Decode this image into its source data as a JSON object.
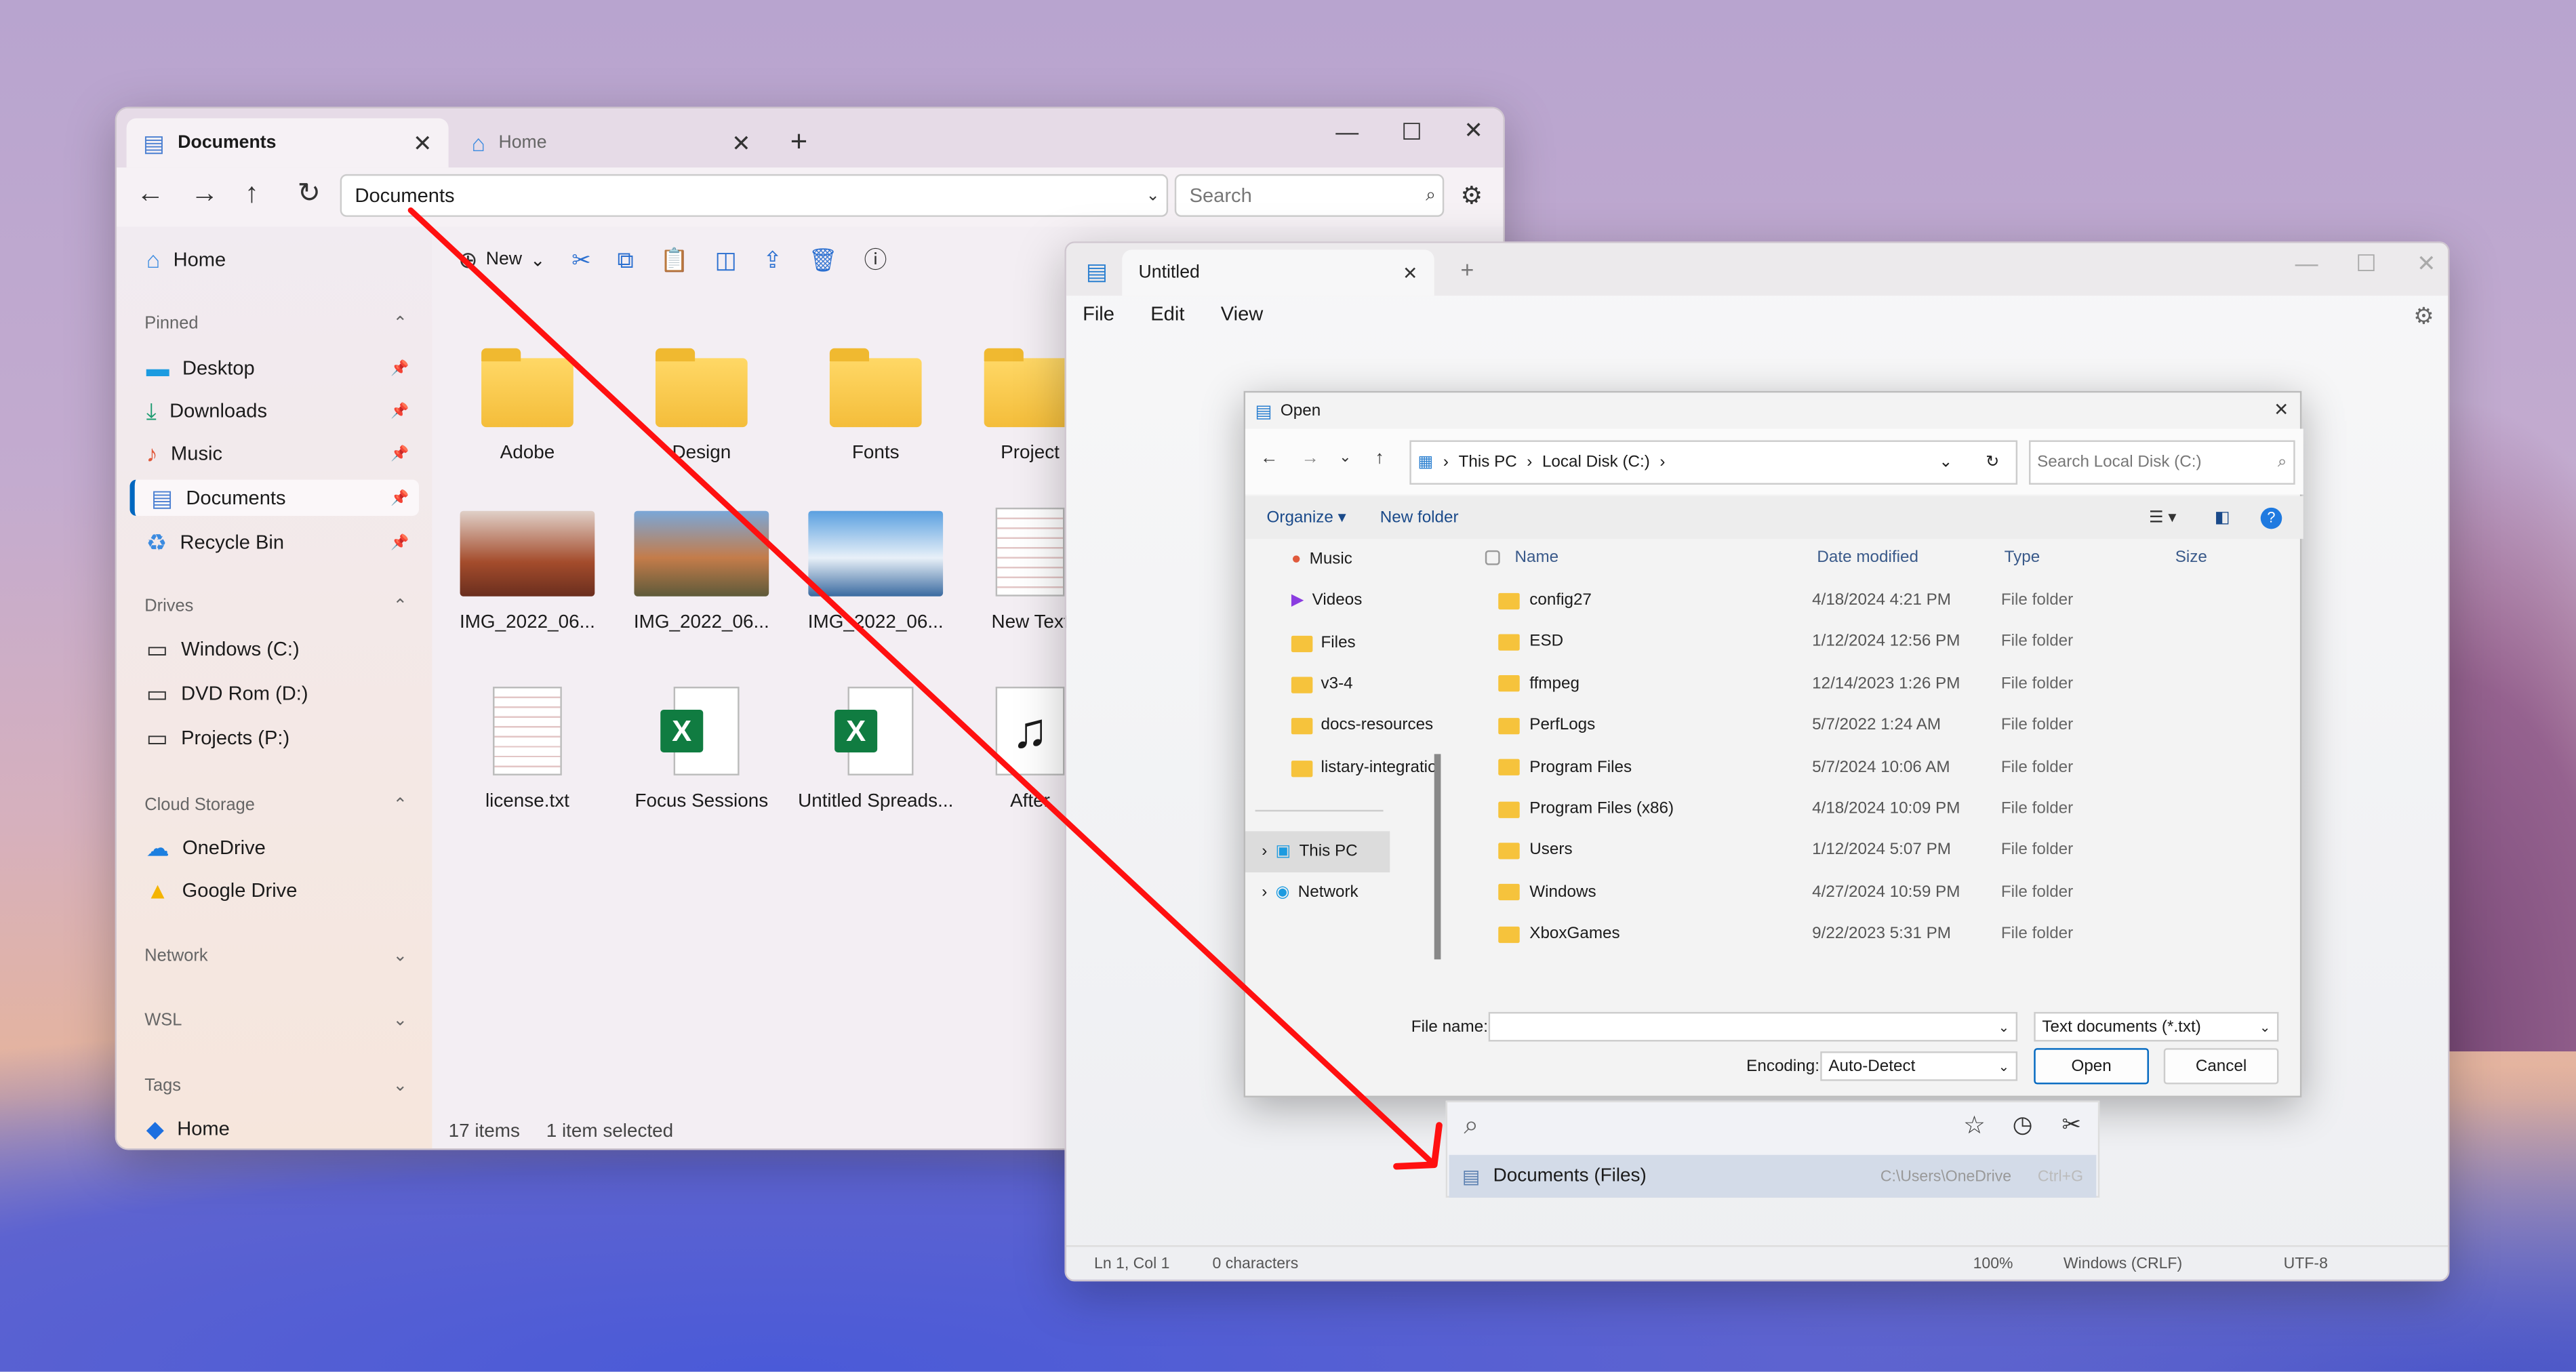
{
  "explorer": {
    "tabs": [
      {
        "label": "Documents",
        "active": true
      },
      {
        "label": "Home",
        "active": false
      }
    ],
    "address": "Documents",
    "search_placeholder": "Search",
    "toolbar": {
      "new_label": "New"
    },
    "sidebar": {
      "home": "Home",
      "pinned_header": "Pinned",
      "pinned": [
        "Desktop",
        "Downloads",
        "Music",
        "Documents",
        "Recycle Bin"
      ],
      "drives_header": "Drives",
      "drives": [
        "Windows (C:)",
        "DVD Rom (D:)",
        "Projects (P:)"
      ],
      "cloud_header": "Cloud Storage",
      "cloud": [
        "OneDrive",
        "Google Drive"
      ],
      "network_header": "Network",
      "wsl_header": "WSL",
      "tags_header": "Tags",
      "tags_home": "Home"
    },
    "items": [
      "Adobe",
      "Design",
      "Fonts",
      "Project",
      "IMG_2022_06...",
      "IMG_2022_06...",
      "IMG_2022_06...",
      "New Text",
      "license.txt",
      "Focus Sessions",
      "Untitled Spreads...",
      "After"
    ],
    "status": {
      "count": "17 items",
      "selected": "1 item selected"
    }
  },
  "notepad": {
    "tab": "Untitled",
    "menu": [
      "File",
      "Edit",
      "View"
    ],
    "status": {
      "position": "Ln 1, Col 1",
      "chars": "0 characters",
      "zoom": "100%",
      "eol": "Windows (CRLF)",
      "encoding": "UTF-8"
    }
  },
  "open_dialog": {
    "title": "Open",
    "breadcrumb": [
      "This PC",
      "Local Disk (C:)"
    ],
    "search_placeholder": "Search Local Disk (C:)",
    "organize": "Organize",
    "new_folder": "New folder",
    "nav": [
      "Music",
      "Videos",
      "Files",
      "v3-4",
      "docs-resources",
      "listary-integratio",
      "This PC",
      "Network"
    ],
    "columns": [
      "Name",
      "Date modified",
      "Type",
      "Size"
    ],
    "rows": [
      {
        "name": "config27",
        "date": "4/18/2024 4:21 PM",
        "type": "File folder"
      },
      {
        "name": "ESD",
        "date": "1/12/2024 12:56 PM",
        "type": "File folder"
      },
      {
        "name": "ffmpeg",
        "date": "12/14/2023 1:26 PM",
        "type": "File folder"
      },
      {
        "name": "PerfLogs",
        "date": "5/7/2022 1:24 AM",
        "type": "File folder"
      },
      {
        "name": "Program Files",
        "date": "5/7/2024 10:06 AM",
        "type": "File folder"
      },
      {
        "name": "Program Files (x86)",
        "date": "4/18/2024 10:09 PM",
        "type": "File folder"
      },
      {
        "name": "Users",
        "date": "1/12/2024 5:07 PM",
        "type": "File folder"
      },
      {
        "name": "Windows",
        "date": "4/27/2024 10:59 PM",
        "type": "File folder"
      },
      {
        "name": "XboxGames",
        "date": "9/22/2023 5:31 PM",
        "type": "File folder"
      }
    ],
    "file_name_label": "File name:",
    "file_name_value": "",
    "file_type": "Text documents (*.txt)",
    "encoding_label": "Encoding:",
    "encoding_value": "Auto-Detect",
    "open": "Open",
    "cancel": "Cancel"
  },
  "listary": {
    "result": "Documents (Files)",
    "path": "C:\\Users\\OneDrive",
    "shortcut": "Ctrl+G"
  },
  "colors": {
    "arrow": "#ff1010",
    "accent": "#0067c0"
  }
}
